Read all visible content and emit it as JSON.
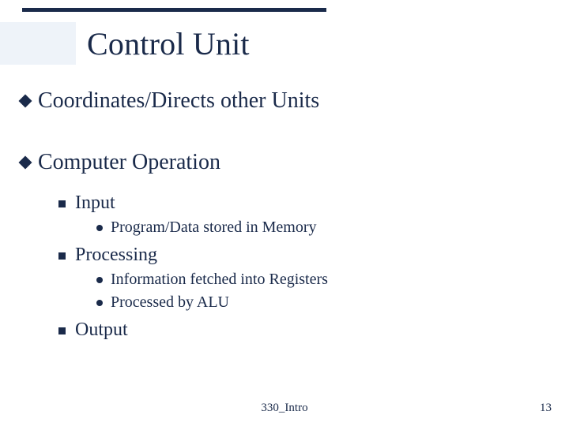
{
  "title": "Control Unit",
  "bullets": {
    "b1": "Coordinates/Directs other Units",
    "b2": "Computer Operation",
    "b2_1": "Input",
    "b2_1_1": "Program/Data stored in Memory",
    "b2_2": "Processing",
    "b2_2_1": "Information fetched into Registers",
    "b2_2_2": "Processed by ALU",
    "b2_3": "Output"
  },
  "footer": {
    "center": "330_Intro",
    "page": "13"
  }
}
